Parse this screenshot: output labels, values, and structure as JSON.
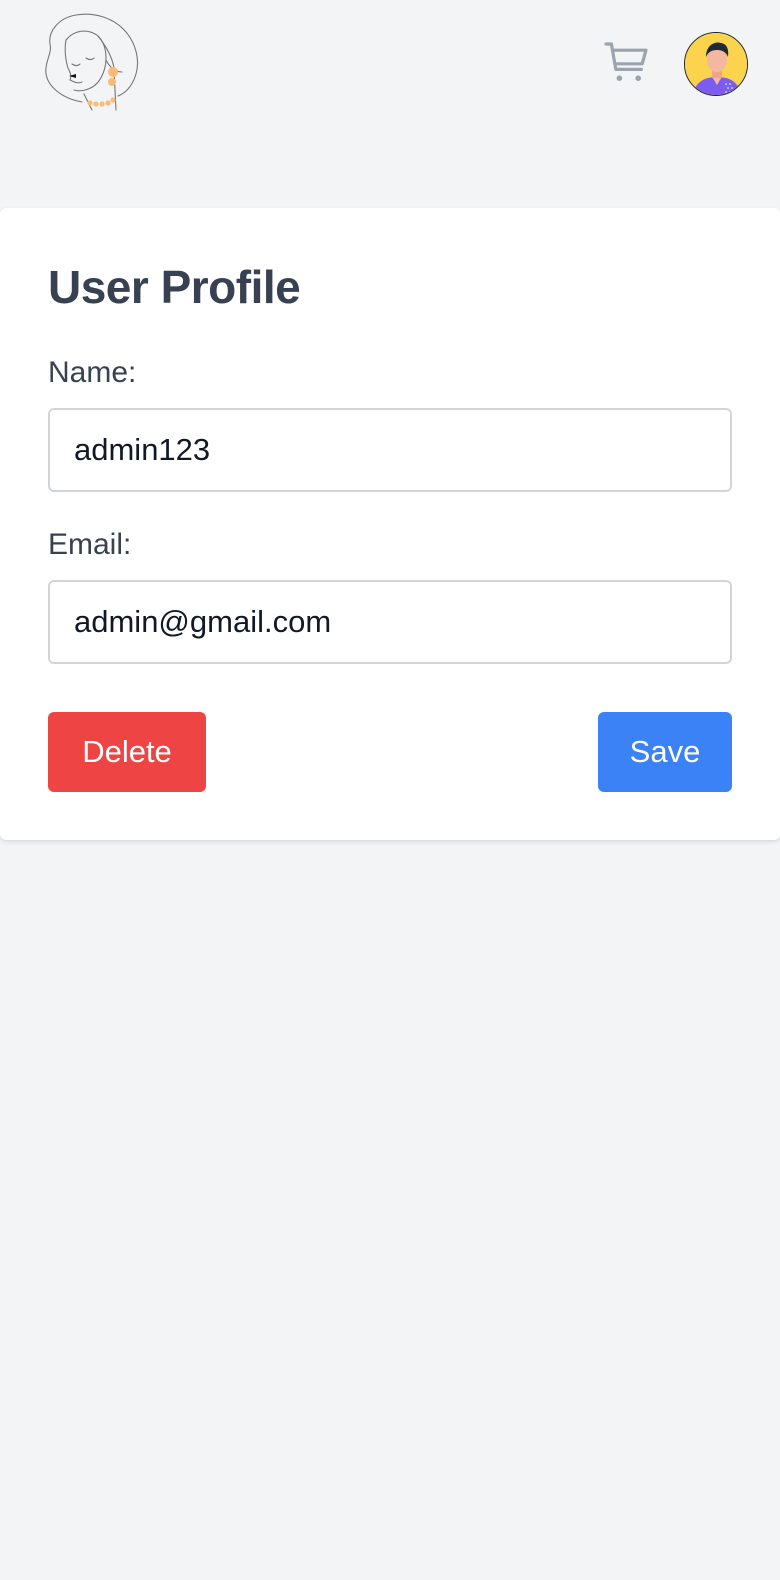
{
  "header": {
    "logo_icon": "woman-line-art-logo-icon",
    "cart_icon": "shopping-cart-icon",
    "avatar_icon": "user-avatar-icon"
  },
  "profile": {
    "title": "User Profile",
    "name_label": "Name:",
    "name_value": "admin123",
    "email_label": "Email:",
    "email_value": "admin@gmail.com",
    "delete_label": "Delete",
    "save_label": "Save"
  },
  "colors": {
    "background": "#f3f4f6",
    "card": "#ffffff",
    "text": "#374151",
    "delete": "#ef4444",
    "save": "#3b82f6",
    "avatar_bg": "#fcd34d"
  }
}
